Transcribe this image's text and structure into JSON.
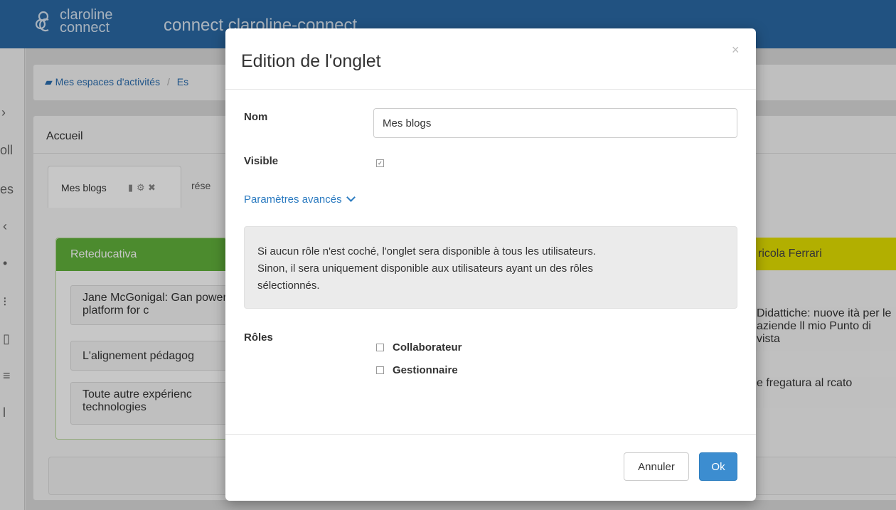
{
  "header": {
    "logo_line1": "claroline",
    "logo_line2": "connect",
    "app_title": "connect claroline-connect"
  },
  "left_strip": [
    "oll",
    "es"
  ],
  "breadcrumb": {
    "item1": "Mes espaces d'activités",
    "separator": "/",
    "item2": "Es"
  },
  "panel": {
    "title": "Accueil",
    "tabs": [
      {
        "label": "Mes blogs"
      },
      {
        "label": "rése"
      }
    ]
  },
  "widget_green": {
    "title": "Reteducativa",
    "items": [
      "Jane McGonigal: Gan powerful platform for c",
      "L'alignement pédagog",
      "Toute autre expérienc technologies"
    ],
    "color": "#62b23b"
  },
  "widget_yellow": {
    "title": "ricola Ferrari",
    "items": [
      "Didattiche: nuove ità per le aziende ll mio Punto di vista",
      "e fregatura al rcato"
    ],
    "color": "#e4e000"
  },
  "modal": {
    "title": "Edition de l'onglet",
    "close_label": "×",
    "name_label": "Nom",
    "name_value": "Mes blogs",
    "visible_label": "Visible",
    "visible_checked": true,
    "advanced_label": "Paramètres avancés",
    "info_text_line1": "Si aucun rôle n'est coché, l'onglet sera disponible à tous les utilisateurs.",
    "info_text_line2": "Sinon, il sera uniquement disponible aux utilisateurs ayant un des rôles",
    "info_text_line3": "sélectionnés.",
    "roles_label": "Rôles",
    "roles": [
      {
        "label": "Collaborateur",
        "checked": false
      },
      {
        "label": "Gestionnaire",
        "checked": false
      }
    ],
    "cancel_label": "Annuler",
    "ok_label": "Ok"
  },
  "colors": {
    "topbar": "#2b6aa6",
    "primary_button": "#3c8dd0",
    "link": "#2a7ac0"
  }
}
